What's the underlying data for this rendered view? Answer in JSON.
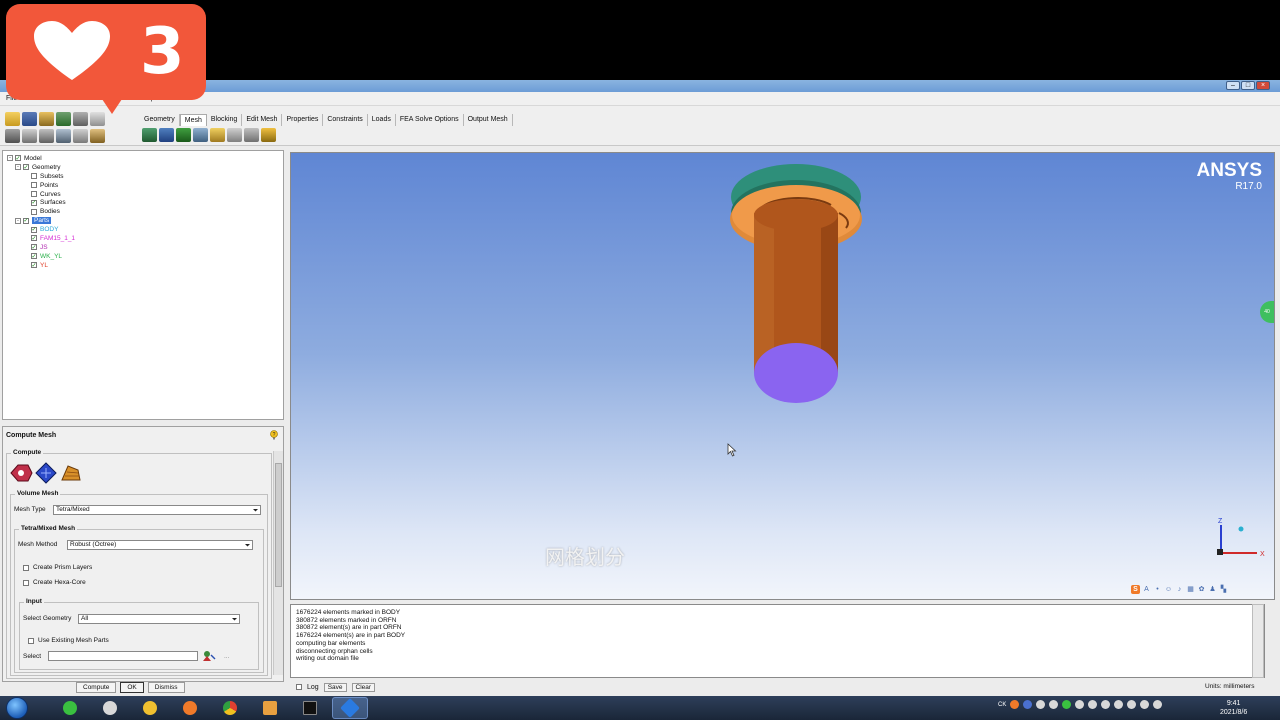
{
  "like_badge": {
    "count": "3"
  },
  "menu": [
    "File",
    "Edit",
    "View",
    "Info",
    "Help"
  ],
  "tabs": [
    "Geometry",
    "Mesh",
    "Blocking",
    "Edit Mesh",
    "Properties",
    "Constraints",
    "Loads",
    "FEA Solve Options",
    "Output Mesh"
  ],
  "active_tab": "Mesh",
  "tree": {
    "model": "Model",
    "geometry": "Geometry",
    "geometry_items": [
      "Subsets",
      "Points",
      "Curves",
      "Surfaces",
      "Bodies"
    ],
    "parts": "Parts",
    "part_items": [
      {
        "label": "BODY",
        "color": "#2aa8d8"
      },
      {
        "label": "FAM15_1_1",
        "color": "#d42ad4"
      },
      {
        "label": "JS",
        "color": "#b02ab0"
      },
      {
        "label": "WK_YL",
        "color": "#2ab04a"
      },
      {
        "label": "YL",
        "color": "#e0402a"
      }
    ]
  },
  "panel": {
    "title": "Compute Mesh",
    "compute_label": "Compute",
    "volume_mesh_label": "Volume Mesh",
    "mesh_type_label": "Mesh Type",
    "mesh_type_value": "Tetra/Mixed",
    "tetra_group_label": "Tetra/Mixed Mesh",
    "mesh_method_label": "Mesh Method",
    "mesh_method_value": "Robust (Octree)",
    "create_prism": "Create Prism Layers",
    "create_hexa": "Create Hexa-Core",
    "input_label": "Input",
    "select_geometry_label": "Select Geometry",
    "select_geometry_value": "All",
    "use_existing": "Use Existing Mesh Parts",
    "select_label": "Select",
    "select_dots": "...",
    "buttons": [
      "Compute",
      "OK",
      "Dismiss"
    ]
  },
  "viewport": {
    "logo": "ANSYS",
    "version": "R17.0",
    "subtitle": "网格划分",
    "axis_z": "Z",
    "axis_x": "X",
    "side_tab": "40"
  },
  "log": {
    "lines": [
      "1676224 elements marked in BODY",
      "380872 elements marked in ORFN",
      "380872 element(s) are in part ORFN",
      "1676224 element(s) are in part BODY",
      "computing bar elements",
      "disconnecting orphan cells",
      "writing out domain file"
    ],
    "log_label": "Log",
    "save_label": "Save",
    "clear_label": "Clear",
    "units": "Units: millimeters"
  },
  "taskbar": {
    "tray_lang": "CK",
    "time": "9:41",
    "date": "2021/8/6"
  },
  "colors": {
    "cylinder": "#b0561c",
    "flange": "#f09a4a",
    "cap": "#2e8f7a",
    "bottom_face": "#8a64f0"
  }
}
